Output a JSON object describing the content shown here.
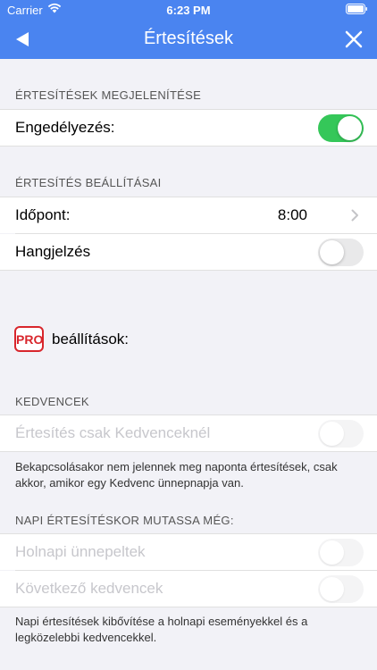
{
  "status": {
    "carrier": "Carrier",
    "time": "6:23 PM"
  },
  "nav": {
    "title": "Értesítések"
  },
  "sections": {
    "display_header": "ÉRTESÍTÉSEK MEGJELENÍTÉSE",
    "settings_header": "ÉRTESÍTÉS BEÁLLÍTÁSAI",
    "favorites_header": "KEDVENCEK",
    "daily_header": "NAPI ÉRTESÍTÉSKOR MUTASSA MÉG:"
  },
  "rows": {
    "enable_label": "Engedélyezés:",
    "time_label": "Időpont:",
    "time_value": "8:00",
    "sound_label": "Hangjelzés",
    "favorites_only_label": "Értesítés csak Kedvenceknél",
    "tomorrow_label": "Holnapi ünnepeltek",
    "next_favorites_label": "Következő kedvencek"
  },
  "toggles": {
    "enable": "on",
    "sound": "off",
    "favorites_only": "disabled",
    "tomorrow": "disabled",
    "next_favorites": "disabled"
  },
  "pro": {
    "badge": "PRO",
    "label": "beállítások:"
  },
  "footers": {
    "favorites_note": "Bekapcsolásakor nem jelennek meg naponta értesítések, csak akkor, amikor egy Kedvenc ünnepnapja van.",
    "daily_note": "Napi értesítések kibővítése a holnapi eseményekkel és a legközelebbi kedvencekkel."
  },
  "colors": {
    "accent": "#4a84f0",
    "toggle_on": "#35c759",
    "pro_red": "#d8262c"
  }
}
